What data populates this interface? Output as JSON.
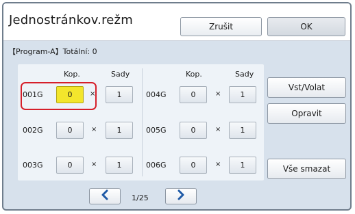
{
  "header": {
    "title": "Jednostránkov.režm",
    "cancel_label": "Zrušit",
    "ok_label": "OK"
  },
  "program": {
    "info": "【Program-A】Totální: 0"
  },
  "columns": {
    "copies": "Kop.",
    "sets": "Sady"
  },
  "groups_left": [
    {
      "label": "001G",
      "copies": "0",
      "separator": "×",
      "sets": "1"
    },
    {
      "label": "002G",
      "copies": "0",
      "separator": "×",
      "sets": "1"
    },
    {
      "label": "003G",
      "copies": "0",
      "separator": "×",
      "sets": "1"
    }
  ],
  "groups_right": [
    {
      "label": "004G",
      "copies": "0",
      "separator": "×",
      "sets": "1"
    },
    {
      "label": "005G",
      "copies": "0",
      "separator": "×",
      "sets": "1"
    },
    {
      "label": "006G",
      "copies": "0",
      "separator": "×",
      "sets": "1"
    }
  ],
  "side": {
    "vst_volat": "Vst/Volat",
    "opravit": "Opravit",
    "vse_smazat": "Vše smazat"
  },
  "pager": {
    "indicator": "1/25",
    "prev_icon": "chevron-left-icon",
    "next_icon": "chevron-right-icon"
  },
  "colors": {
    "selected_field": "#f3e62c",
    "selection_frame": "#d61f2a",
    "panel_bg": "#d7e1ec",
    "arrow": "#1f5aa6"
  }
}
